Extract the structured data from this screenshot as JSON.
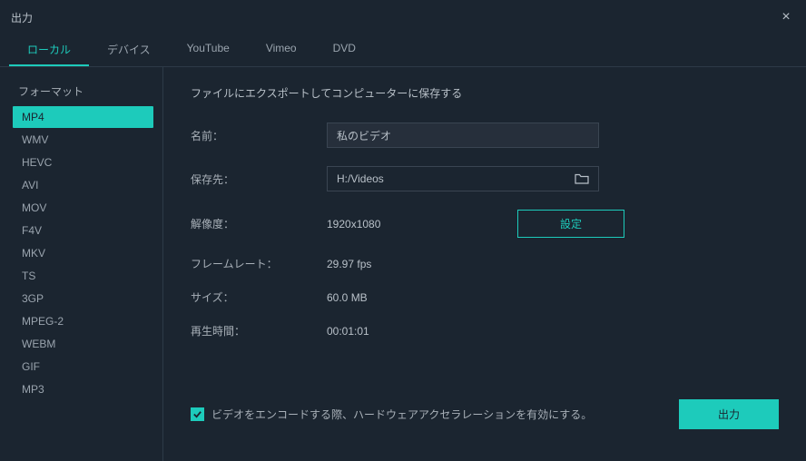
{
  "window": {
    "title": "出力"
  },
  "tabs": [
    {
      "label": "ローカル",
      "active": true
    },
    {
      "label": "デバイス",
      "active": false
    },
    {
      "label": "YouTube",
      "active": false
    },
    {
      "label": "Vimeo",
      "active": false
    },
    {
      "label": "DVD",
      "active": false
    }
  ],
  "sidebar": {
    "title": "フォーマット",
    "formats": [
      {
        "label": "MP4",
        "selected": true
      },
      {
        "label": "WMV",
        "selected": false
      },
      {
        "label": "HEVC",
        "selected": false
      },
      {
        "label": "AVI",
        "selected": false
      },
      {
        "label": "MOV",
        "selected": false
      },
      {
        "label": "F4V",
        "selected": false
      },
      {
        "label": "MKV",
        "selected": false
      },
      {
        "label": "TS",
        "selected": false
      },
      {
        "label": "3GP",
        "selected": false
      },
      {
        "label": "MPEG-2",
        "selected": false
      },
      {
        "label": "WEBM",
        "selected": false
      },
      {
        "label": "GIF",
        "selected": false
      },
      {
        "label": "MP3",
        "selected": false
      }
    ]
  },
  "main": {
    "heading": "ファイルにエクスポートしてコンピューターに保存する",
    "fields": {
      "name_label": "名前：",
      "name_value": "私のビデオ",
      "save_to_label": "保存先：",
      "save_to_value": "H:/Videos",
      "resolution_label": "解像度：",
      "resolution_value": "1920x1080",
      "settings_button": "設定",
      "framerate_label": "フレームレート：",
      "framerate_value": "29.97 fps",
      "size_label": "サイズ：",
      "size_value": "60.0 MB",
      "duration_label": "再生時間：",
      "duration_value": "00:01:01"
    },
    "hwaccel_label": "ビデオをエンコードする際、ハードウェアアクセラレーションを有効にする。",
    "hwaccel_checked": true,
    "export_button": "出力"
  }
}
